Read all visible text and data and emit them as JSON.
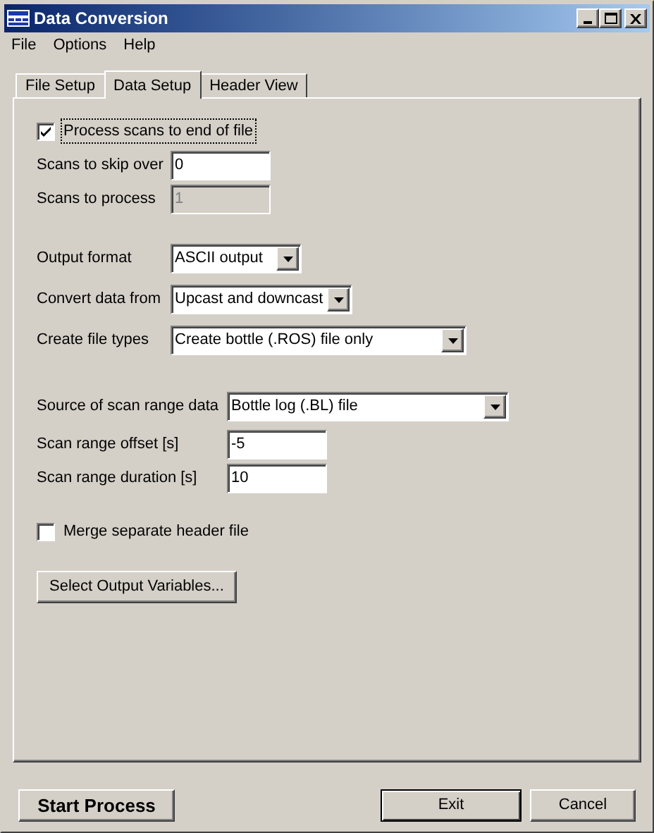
{
  "window": {
    "title": "Data Conversion"
  },
  "menu": [
    "File",
    "Options",
    "Help"
  ],
  "tabs": [
    {
      "label": "File Setup",
      "selected": false
    },
    {
      "label": "Data Setup",
      "selected": true
    },
    {
      "label": "Header View",
      "selected": false
    }
  ],
  "groups": [
    [
      {
        "kind": "checkbox",
        "label": "Process scans to end of file",
        "checked": true,
        "focused": true
      },
      {
        "kind": "field",
        "label": "Scans to skip over",
        "value": "0",
        "disabled": false
      },
      {
        "kind": "field",
        "label": "Scans to process",
        "value": "1",
        "disabled": true
      }
    ],
    [
      {
        "kind": "dropdown",
        "label": "Output format",
        "value": "ASCII output"
      },
      {
        "kind": "dropdown",
        "label": "Convert data from",
        "value": "Upcast and downcast"
      },
      {
        "kind": "dropdown",
        "label": "Create file types",
        "value": "Create bottle (.ROS) file only"
      }
    ],
    [
      {
        "kind": "dropdown",
        "label": "Source of scan range data",
        "value": "Bottle log (.BL) file"
      },
      {
        "kind": "field",
        "label": "Scan range offset [s]",
        "value": "-5",
        "disabled": false
      },
      {
        "kind": "field",
        "label": "Scan range duration [s]",
        "value": "10",
        "disabled": false
      }
    ],
    [
      {
        "kind": "checkbox",
        "label": "Merge separate header file",
        "checked": false,
        "focused": false
      }
    ],
    [
      {
        "kind": "button",
        "label": "Select Output Variables..."
      }
    ]
  ],
  "footer": {
    "start": "Start Process",
    "exit": "Exit",
    "cancel": "Cancel"
  }
}
